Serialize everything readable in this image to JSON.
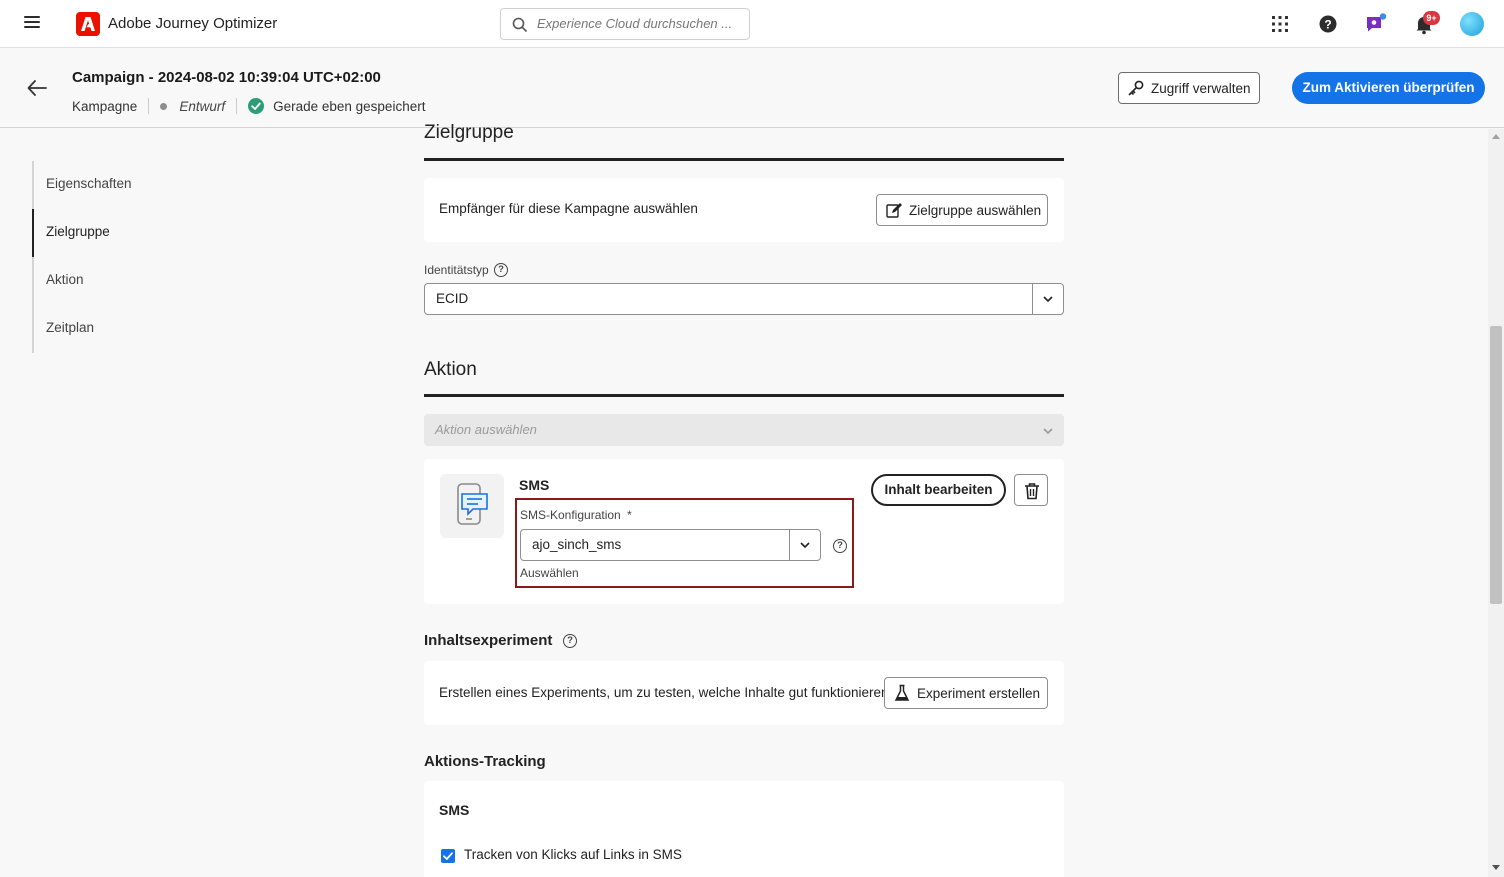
{
  "app": {
    "name": "Adobe Journey Optimizer",
    "search_placeholder": "Experience Cloud durchsuchen ...",
    "notification_count": "9+",
    "brand_color": "#eb1000",
    "accent_color": "#1473e6"
  },
  "header": {
    "title": "Campaign - 2024-08-02 10:39:04 UTC+02:00",
    "type": "Kampagne",
    "status": "Entwurf",
    "save_status": "Gerade eben gespeichert",
    "manage_access_label": "Zugriff verwalten",
    "review_label": "Zum Aktivieren überprüfen"
  },
  "sidebar": {
    "items": [
      {
        "label": "Eigenschaften"
      },
      {
        "label": "Zielgruppe",
        "active": true
      },
      {
        "label": "Aktion"
      },
      {
        "label": "Zeitplan"
      }
    ]
  },
  "audience": {
    "heading": "Zielgruppe",
    "prompt": "Empfänger für diese Kampagne auswählen",
    "select_label": "Zielgruppe auswählen",
    "identity_label": "Identitätstyp",
    "identity_value": "ECID"
  },
  "action": {
    "heading": "Aktion",
    "select_placeholder": "Aktion auswählen",
    "channel": "SMS",
    "config_label": "SMS-Konfiguration",
    "config_required": "*",
    "config_value": "ajo_sinch_sms",
    "config_hint": "Auswählen",
    "edit_content_label": "Inhalt bearbeiten"
  },
  "experiment": {
    "heading": "Inhaltsexperiment",
    "text": "Erstellen eines Experiments, um zu testen, welche Inhalte gut funktionieren.",
    "button_label": "Experiment erstellen"
  },
  "tracking": {
    "heading": "Aktions-Tracking",
    "channel": "SMS",
    "checkbox_label": "Tracken von Klicks auf Links in SMS",
    "checked": true
  }
}
